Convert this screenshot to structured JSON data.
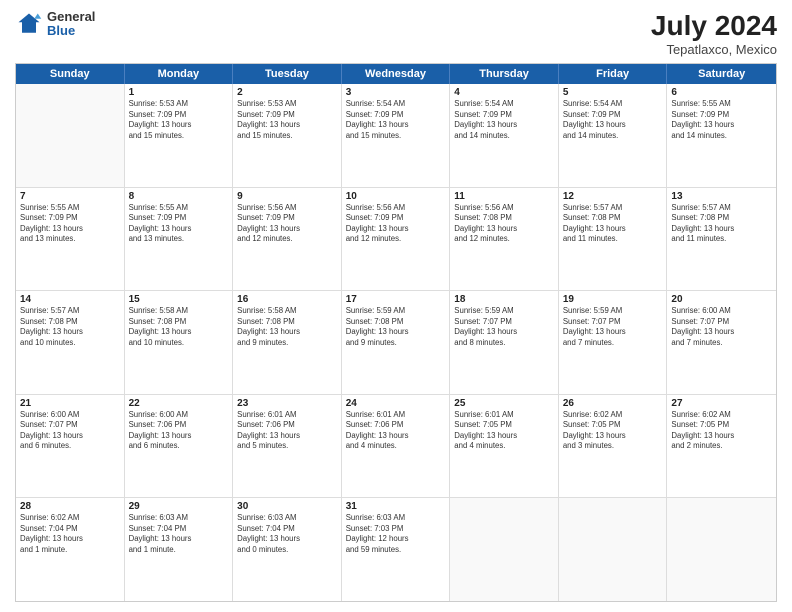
{
  "header": {
    "logo_general": "General",
    "logo_blue": "Blue",
    "month_year": "July 2024",
    "location": "Tepatlaxco, Mexico"
  },
  "days_of_week": [
    "Sunday",
    "Monday",
    "Tuesday",
    "Wednesday",
    "Thursday",
    "Friday",
    "Saturday"
  ],
  "rows": [
    [
      {
        "day": "",
        "info": ""
      },
      {
        "day": "1",
        "info": "Sunrise: 5:53 AM\nSunset: 7:09 PM\nDaylight: 13 hours\nand 15 minutes."
      },
      {
        "day": "2",
        "info": "Sunrise: 5:53 AM\nSunset: 7:09 PM\nDaylight: 13 hours\nand 15 minutes."
      },
      {
        "day": "3",
        "info": "Sunrise: 5:54 AM\nSunset: 7:09 PM\nDaylight: 13 hours\nand 15 minutes."
      },
      {
        "day": "4",
        "info": "Sunrise: 5:54 AM\nSunset: 7:09 PM\nDaylight: 13 hours\nand 14 minutes."
      },
      {
        "day": "5",
        "info": "Sunrise: 5:54 AM\nSunset: 7:09 PM\nDaylight: 13 hours\nand 14 minutes."
      },
      {
        "day": "6",
        "info": "Sunrise: 5:55 AM\nSunset: 7:09 PM\nDaylight: 13 hours\nand 14 minutes."
      }
    ],
    [
      {
        "day": "7",
        "info": "Sunrise: 5:55 AM\nSunset: 7:09 PM\nDaylight: 13 hours\nand 13 minutes."
      },
      {
        "day": "8",
        "info": "Sunrise: 5:55 AM\nSunset: 7:09 PM\nDaylight: 13 hours\nand 13 minutes."
      },
      {
        "day": "9",
        "info": "Sunrise: 5:56 AM\nSunset: 7:09 PM\nDaylight: 13 hours\nand 12 minutes."
      },
      {
        "day": "10",
        "info": "Sunrise: 5:56 AM\nSunset: 7:09 PM\nDaylight: 13 hours\nand 12 minutes."
      },
      {
        "day": "11",
        "info": "Sunrise: 5:56 AM\nSunset: 7:08 PM\nDaylight: 13 hours\nand 12 minutes."
      },
      {
        "day": "12",
        "info": "Sunrise: 5:57 AM\nSunset: 7:08 PM\nDaylight: 13 hours\nand 11 minutes."
      },
      {
        "day": "13",
        "info": "Sunrise: 5:57 AM\nSunset: 7:08 PM\nDaylight: 13 hours\nand 11 minutes."
      }
    ],
    [
      {
        "day": "14",
        "info": "Sunrise: 5:57 AM\nSunset: 7:08 PM\nDaylight: 13 hours\nand 10 minutes."
      },
      {
        "day": "15",
        "info": "Sunrise: 5:58 AM\nSunset: 7:08 PM\nDaylight: 13 hours\nand 10 minutes."
      },
      {
        "day": "16",
        "info": "Sunrise: 5:58 AM\nSunset: 7:08 PM\nDaylight: 13 hours\nand 9 minutes."
      },
      {
        "day": "17",
        "info": "Sunrise: 5:59 AM\nSunset: 7:08 PM\nDaylight: 13 hours\nand 9 minutes."
      },
      {
        "day": "18",
        "info": "Sunrise: 5:59 AM\nSunset: 7:07 PM\nDaylight: 13 hours\nand 8 minutes."
      },
      {
        "day": "19",
        "info": "Sunrise: 5:59 AM\nSunset: 7:07 PM\nDaylight: 13 hours\nand 7 minutes."
      },
      {
        "day": "20",
        "info": "Sunrise: 6:00 AM\nSunset: 7:07 PM\nDaylight: 13 hours\nand 7 minutes."
      }
    ],
    [
      {
        "day": "21",
        "info": "Sunrise: 6:00 AM\nSunset: 7:07 PM\nDaylight: 13 hours\nand 6 minutes."
      },
      {
        "day": "22",
        "info": "Sunrise: 6:00 AM\nSunset: 7:06 PM\nDaylight: 13 hours\nand 6 minutes."
      },
      {
        "day": "23",
        "info": "Sunrise: 6:01 AM\nSunset: 7:06 PM\nDaylight: 13 hours\nand 5 minutes."
      },
      {
        "day": "24",
        "info": "Sunrise: 6:01 AM\nSunset: 7:06 PM\nDaylight: 13 hours\nand 4 minutes."
      },
      {
        "day": "25",
        "info": "Sunrise: 6:01 AM\nSunset: 7:05 PM\nDaylight: 13 hours\nand 4 minutes."
      },
      {
        "day": "26",
        "info": "Sunrise: 6:02 AM\nSunset: 7:05 PM\nDaylight: 13 hours\nand 3 minutes."
      },
      {
        "day": "27",
        "info": "Sunrise: 6:02 AM\nSunset: 7:05 PM\nDaylight: 13 hours\nand 2 minutes."
      }
    ],
    [
      {
        "day": "28",
        "info": "Sunrise: 6:02 AM\nSunset: 7:04 PM\nDaylight: 13 hours\nand 1 minute."
      },
      {
        "day": "29",
        "info": "Sunrise: 6:03 AM\nSunset: 7:04 PM\nDaylight: 13 hours\nand 1 minute."
      },
      {
        "day": "30",
        "info": "Sunrise: 6:03 AM\nSunset: 7:04 PM\nDaylight: 13 hours\nand 0 minutes."
      },
      {
        "day": "31",
        "info": "Sunrise: 6:03 AM\nSunset: 7:03 PM\nDaylight: 12 hours\nand 59 minutes."
      },
      {
        "day": "",
        "info": ""
      },
      {
        "day": "",
        "info": ""
      },
      {
        "day": "",
        "info": ""
      }
    ]
  ]
}
